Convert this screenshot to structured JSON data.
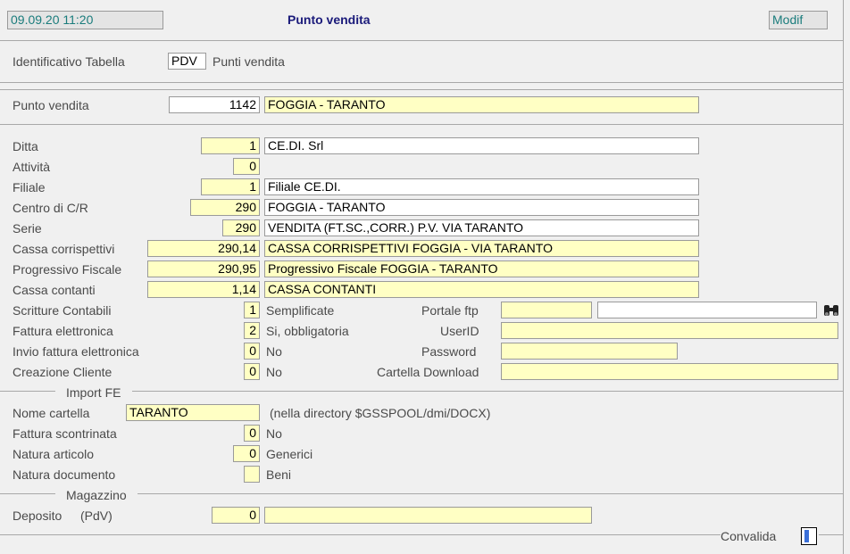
{
  "header": {
    "datetime": "09.09.20 11:20",
    "title": "Punto vendita",
    "mode": "Modif"
  },
  "id_table": {
    "label": "Identificativo Tabella",
    "code": "PDV",
    "description": "Punti vendita"
  },
  "punto_vendita": {
    "label": "Punto vendita",
    "code": "1142",
    "description": "FOGGIA - TARANTO"
  },
  "fields": {
    "ditta": {
      "label": "Ditta",
      "code": "1",
      "description": "CE.DI. Srl"
    },
    "attivita": {
      "label": "Attività",
      "code": "0"
    },
    "filiale": {
      "label": "Filiale",
      "code": "1",
      "description": "Filiale CE.DI."
    },
    "centro": {
      "label": "Centro di C/R",
      "code": "290",
      "description": "FOGGIA - TARANTO"
    },
    "serie": {
      "label": "Serie",
      "code": "290",
      "description": "VENDITA (FT.SC.,CORR.) P.V. VIA TARANTO"
    },
    "cassa_corr": {
      "label": "Cassa corrispettivi",
      "code": "290,14",
      "description": "CASSA CORRISPETTIVI FOGGIA - VIA TARANTO"
    },
    "progressivo": {
      "label": "Progressivo Fiscale",
      "code": "290,95",
      "description": "Progressivo Fiscale FOGGIA - TARANTO"
    },
    "cassa_cont": {
      "label": "Cassa contanti",
      "code": "1,14",
      "description": "CASSA CONTANTI"
    },
    "scritture": {
      "label": "Scritture Contabili",
      "code": "1",
      "description": "Semplificate"
    },
    "fattura_el": {
      "label": "Fattura elettronica",
      "code": "2",
      "description": "Si, obbligatoria"
    },
    "invio_fattura": {
      "label": "Invio fattura elettronica",
      "code": "0",
      "description": "No"
    },
    "creazione_cliente": {
      "label": "Creazione Cliente",
      "code": "0",
      "description": "No"
    }
  },
  "right_fields": {
    "portale_ftp": {
      "label": "Portale ftp",
      "value1": "",
      "value2": ""
    },
    "userid": {
      "label": "UserID",
      "value": ""
    },
    "password": {
      "label": "Password",
      "value": ""
    },
    "cartella_download": {
      "label": "Cartella Download",
      "value": ""
    }
  },
  "import_fe": {
    "section_title": "Import FE",
    "nome_cartella": {
      "label": "Nome cartella",
      "value": "TARANTO",
      "note": "(nella directory $GSSPOOL/dmi/DOCX)"
    },
    "fattura_scontrinata": {
      "label": "Fattura scontrinata",
      "code": "0",
      "description": "No"
    },
    "natura_articolo": {
      "label": "Natura articolo",
      "code": "0",
      "description": "Generici"
    },
    "natura_documento": {
      "label": "Natura documento",
      "code": "",
      "description": "Beni"
    }
  },
  "magazzino": {
    "section_title": "Magazzino",
    "deposito": {
      "label": "Deposito",
      "sublabel": "(PdV)",
      "code": "0",
      "description": ""
    }
  },
  "footer": {
    "convalida_label": "Convalida"
  },
  "icons": {
    "binoculars": "binoculars-icon"
  }
}
